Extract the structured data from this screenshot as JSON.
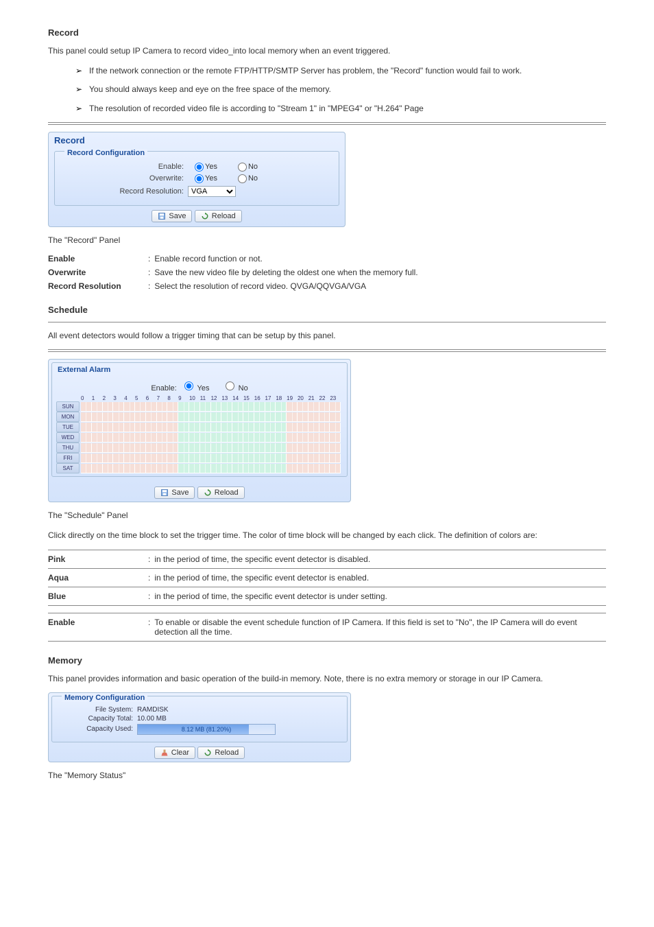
{
  "record_section": {
    "heading": "Record",
    "intro": "This panel could setup IP Camera to record video_into local memory when an event triggered.",
    "bullets": [
      "If the network connection or the remote FTP/HTTP/SMTP Server has problem, the \"Record\" function would fail to work.",
      "You should always keep and eye on the free space of the memory.",
      "The resolution of recorded video file is according to \"Stream 1\" in \"MPEG4\" or \"H.264\" Page"
    ],
    "config_title": "Record Configuration",
    "labels": {
      "enable": "Enable:",
      "overwrite": "Overwrite:",
      "resolution": "Record Resolution:"
    },
    "opts": {
      "yes": "Yes",
      "no": "No"
    },
    "resolution_value": "VGA",
    "btn_save": "Save",
    "btn_reload": "Reload",
    "alt_text": "The \"Record\" Panel",
    "params": [
      {
        "name": "Enable",
        "desc": "Enable record function or not."
      },
      {
        "name": "Overwrite",
        "desc": "Save the new video file by deleting the oldest one when the memory full."
      },
      {
        "name": "Record Resolution",
        "desc": "Select the resolution of record video. QVGA/QQVGA/VGA"
      }
    ]
  },
  "schedule_section": {
    "heading": "Schedule",
    "intro": "All event detectors would follow a trigger timing that can be setup by this panel.",
    "panel_title": "External Alarm",
    "enable_label": "Enable:",
    "opts": {
      "yes": "Yes",
      "no": "No"
    },
    "hours": [
      "0",
      "1",
      "2",
      "3",
      "4",
      "5",
      "6",
      "7",
      "8",
      "9",
      "10",
      "11",
      "12",
      "13",
      "14",
      "15",
      "16",
      "17",
      "18",
      "19",
      "20",
      "21",
      "22",
      "23"
    ],
    "days": [
      "SUN",
      "MON",
      "TUE",
      "WED",
      "THU",
      "FRI",
      "SAT"
    ],
    "btn_save": "Save",
    "btn_reload": "Reload",
    "alt_text": "The \"Schedule\" Panel",
    "usage_intro": "Click directly on the time block to set the trigger time. The color of time block will be changed by each click. The definition of colors are:",
    "colors": [
      {
        "name": "Pink",
        "desc": "in the period of time, the specific event detector is disabled."
      },
      {
        "name": "Aqua",
        "desc": "in the period of time, the specific event detector is enabled."
      },
      {
        "name": "Blue",
        "desc": "in the period of time, the specific event detector is under setting."
      }
    ],
    "params": [
      {
        "name": "Enable",
        "desc": "To enable or disable the event schedule function of IP Camera. If this field is set to \"No\", the IP Camera will do event detection all the time."
      }
    ]
  },
  "memory_section": {
    "heading": "Memory",
    "intro": "This panel provides information and basic operation of the build-in memory. Note, there is no extra memory or storage in our IP Camera.",
    "panel_title": "Memory Configuration",
    "labels": {
      "filesystem": "File System:",
      "cap_total": "Capacity Total:",
      "cap_used": "Capacity Used:"
    },
    "values": {
      "filesystem": "RAMDISK",
      "cap_total": "10.00 MB",
      "used_text": "8.12 MB (81.20%)",
      "used_pct": 81.2
    },
    "btn_clear": "Clear",
    "btn_reload": "Reload",
    "alt_text": "The \"Memory Status\""
  }
}
